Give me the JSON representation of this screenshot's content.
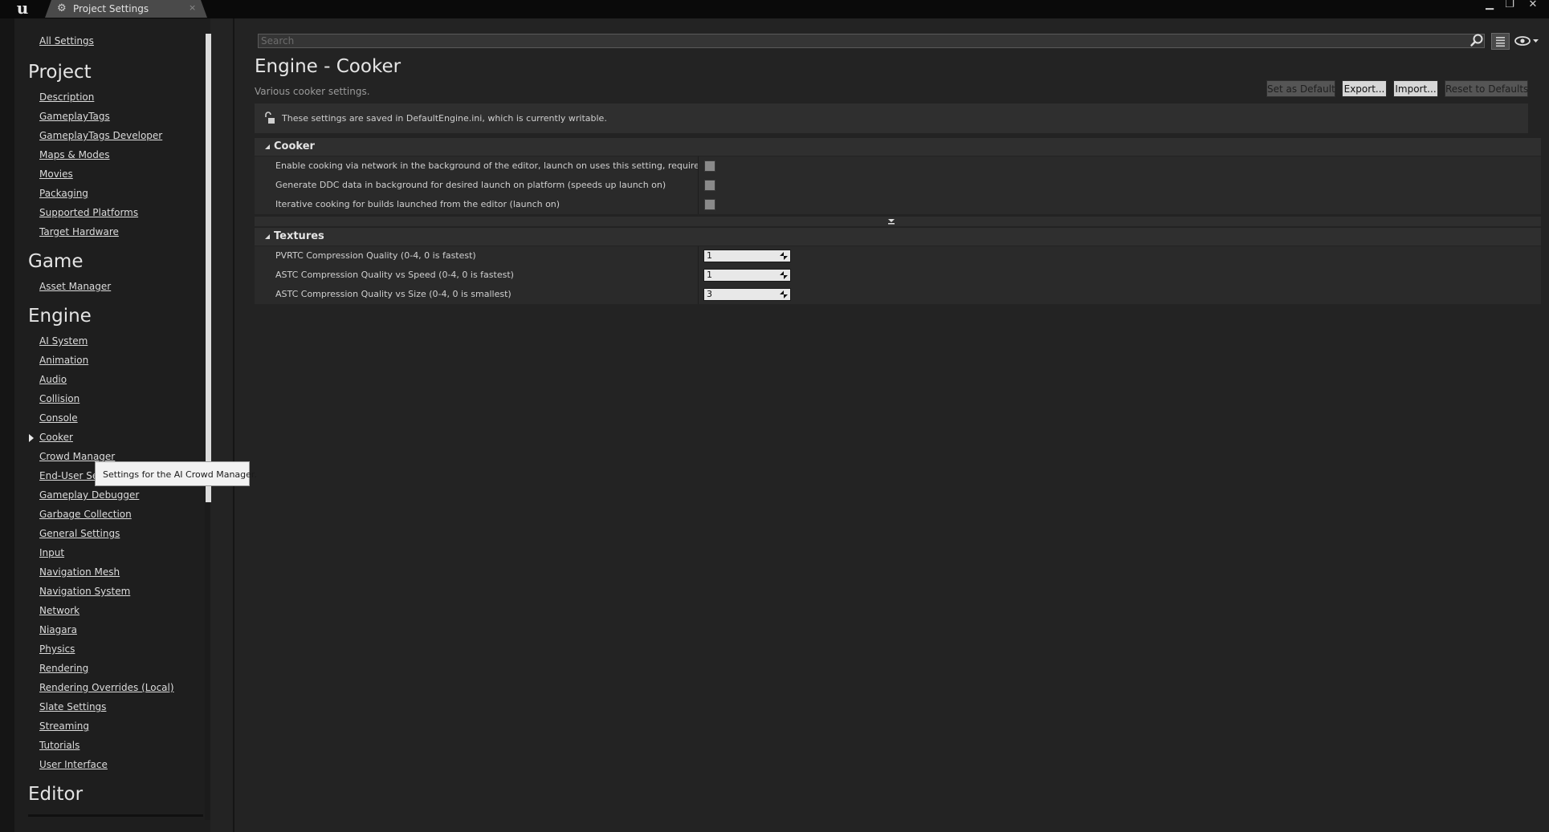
{
  "window": {
    "tab_title": "Project Settings",
    "tab_close": "×",
    "logo_glyph": "u",
    "controls": [
      "minimize",
      "restore",
      "close"
    ]
  },
  "sidebar": {
    "all_settings": "All Settings",
    "sections": [
      {
        "title": "Project",
        "items": [
          "Description",
          "GameplayTags",
          "GameplayTags Developer",
          "Maps & Modes",
          "Movies",
          "Packaging",
          "Supported Platforms",
          "Target Hardware"
        ]
      },
      {
        "title": "Game",
        "items": [
          "Asset Manager"
        ]
      },
      {
        "title": "Engine",
        "items": [
          "AI System",
          "Animation",
          "Audio",
          "Collision",
          "Console",
          "Cooker",
          "Crowd Manager",
          "End-User Se",
          "Gameplay Debugger",
          "Garbage Collection",
          "General Settings",
          "Input",
          "Navigation Mesh",
          "Navigation System",
          "Network",
          "Niagara",
          "Physics",
          "Rendering",
          "Rendering Overrides (Local)",
          "Slate Settings",
          "Streaming",
          "Tutorials",
          "User Interface"
        ]
      },
      {
        "title": "Editor",
        "items": []
      }
    ],
    "selected": "Cooker",
    "tooltip": "Settings for the AI Crowd Manager."
  },
  "search": {
    "placeholder": "Search",
    "value": ""
  },
  "header": {
    "title": "Engine - Cooker",
    "subtitle": "Various cooker settings.",
    "buttons": {
      "set_default": "Set as Default",
      "export": "Export...",
      "import": "Import...",
      "reset": "Reset to Defaults"
    }
  },
  "notice": "These settings are saved in DefaultEngine.ini, which is currently writable.",
  "categories": {
    "cooker": {
      "title": "Cooker",
      "rows": [
        {
          "label": "Enable cooking via network in the background of the editor, launch on uses this setting, requires device to",
          "checked": false
        },
        {
          "label": "Generate DDC data in background for desired launch on platform (speeds up launch on)",
          "checked": false
        },
        {
          "label": "Iterative cooking for builds launched from the editor (launch on)",
          "checked": false
        }
      ]
    },
    "textures": {
      "title": "Textures",
      "rows": [
        {
          "label": "PVRTC Compression Quality (0-4, 0 is fastest)",
          "value": "1"
        },
        {
          "label": "ASTC Compression Quality vs Speed (0-4, 0 is fastest)",
          "value": "1"
        },
        {
          "label": "ASTC Compression Quality vs Size (0-4, 0 is smallest)",
          "value": "3"
        }
      ]
    }
  }
}
